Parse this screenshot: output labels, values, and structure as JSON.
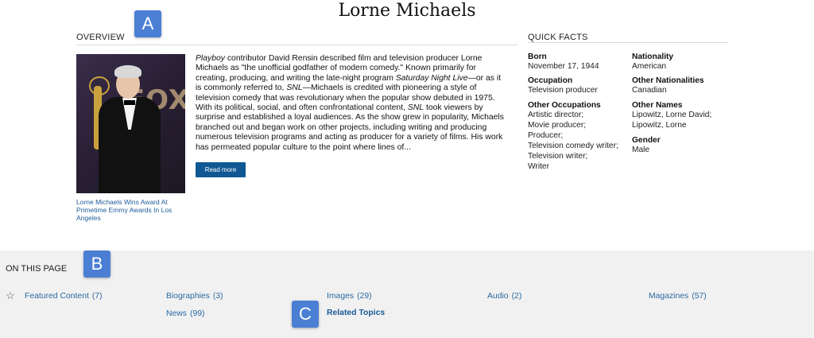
{
  "page": {
    "title": "Lorne Michaels"
  },
  "overview": {
    "heading": "OVERVIEW",
    "image_caption": "Lorne Michaels Wins Award At Primetime Emmy Awards In Los Angeles",
    "image_bg_text": "FOX",
    "paragraph": {
      "p1_italic": "Playboy",
      "p2": " contributor David Rensin described film and television producer Lorne Michaels as \"the unofficial godfather of modern comedy.\" Known primarily for creating, producing, and writing the late-night program ",
      "p3_italic": "Saturday Night Live",
      "p4": "—or as it is commonly referred to, ",
      "p5_italic": "SNL",
      "p6": "—Michaels is credited with pioneering a style of television comedy that was revolutionary when the popular show debuted in 1975. With its political, social, and often confrontational content, ",
      "p7_italic": "SNL",
      "p8": " took viewers by surprise and established a loyal audiences. As the show grew in popularity, Michaels branched out and began work on other projects, including writing and producing numerous television programs and acting as producer for a variety of films. His work has permeated popular culture to the point where lines of..."
    },
    "read_more_label": "Read more"
  },
  "quick_facts": {
    "heading": "QUICK FACTS",
    "born": {
      "label": "Born",
      "value": "November 17, 1944"
    },
    "occupation": {
      "label": "Occupation",
      "value": "Television producer"
    },
    "other_occupations": {
      "label": "Other Occupations",
      "values": [
        "Artistic director;",
        "Movie producer;",
        "Producer;",
        "Television comedy writer;",
        "Television writer;",
        "Writer"
      ]
    },
    "nationality": {
      "label": "Nationality",
      "value": "American"
    },
    "other_nationalities": {
      "label": "Other Nationalities",
      "value": "Canadian"
    },
    "other_names": {
      "label": "Other Names",
      "values": [
        "Lipowitz, Lorne David;",
        "Lipowitz, Lorne"
      ]
    },
    "gender": {
      "label": "Gender",
      "value": "Male"
    }
  },
  "on_this_page": {
    "heading": "ON THIS PAGE",
    "links": {
      "featured": {
        "label": "Featured Content",
        "count": "(7)"
      },
      "biographies": {
        "label": "Biographies",
        "count": "(3)"
      },
      "images": {
        "label": "Images",
        "count": "(29)"
      },
      "audio": {
        "label": "Audio",
        "count": "(2)"
      },
      "magazines": {
        "label": "Magazines",
        "count": "(57)"
      },
      "news": {
        "label": "News",
        "count": "(99)"
      },
      "related": {
        "label": "Related Topics"
      }
    }
  },
  "annotations": {
    "a": "A",
    "b": "B",
    "c": "C"
  },
  "colors": {
    "link": "#2b6aa3",
    "button": "#0f5893",
    "badge": "#4a7fd4",
    "section_bg": "#f1f1f1"
  }
}
